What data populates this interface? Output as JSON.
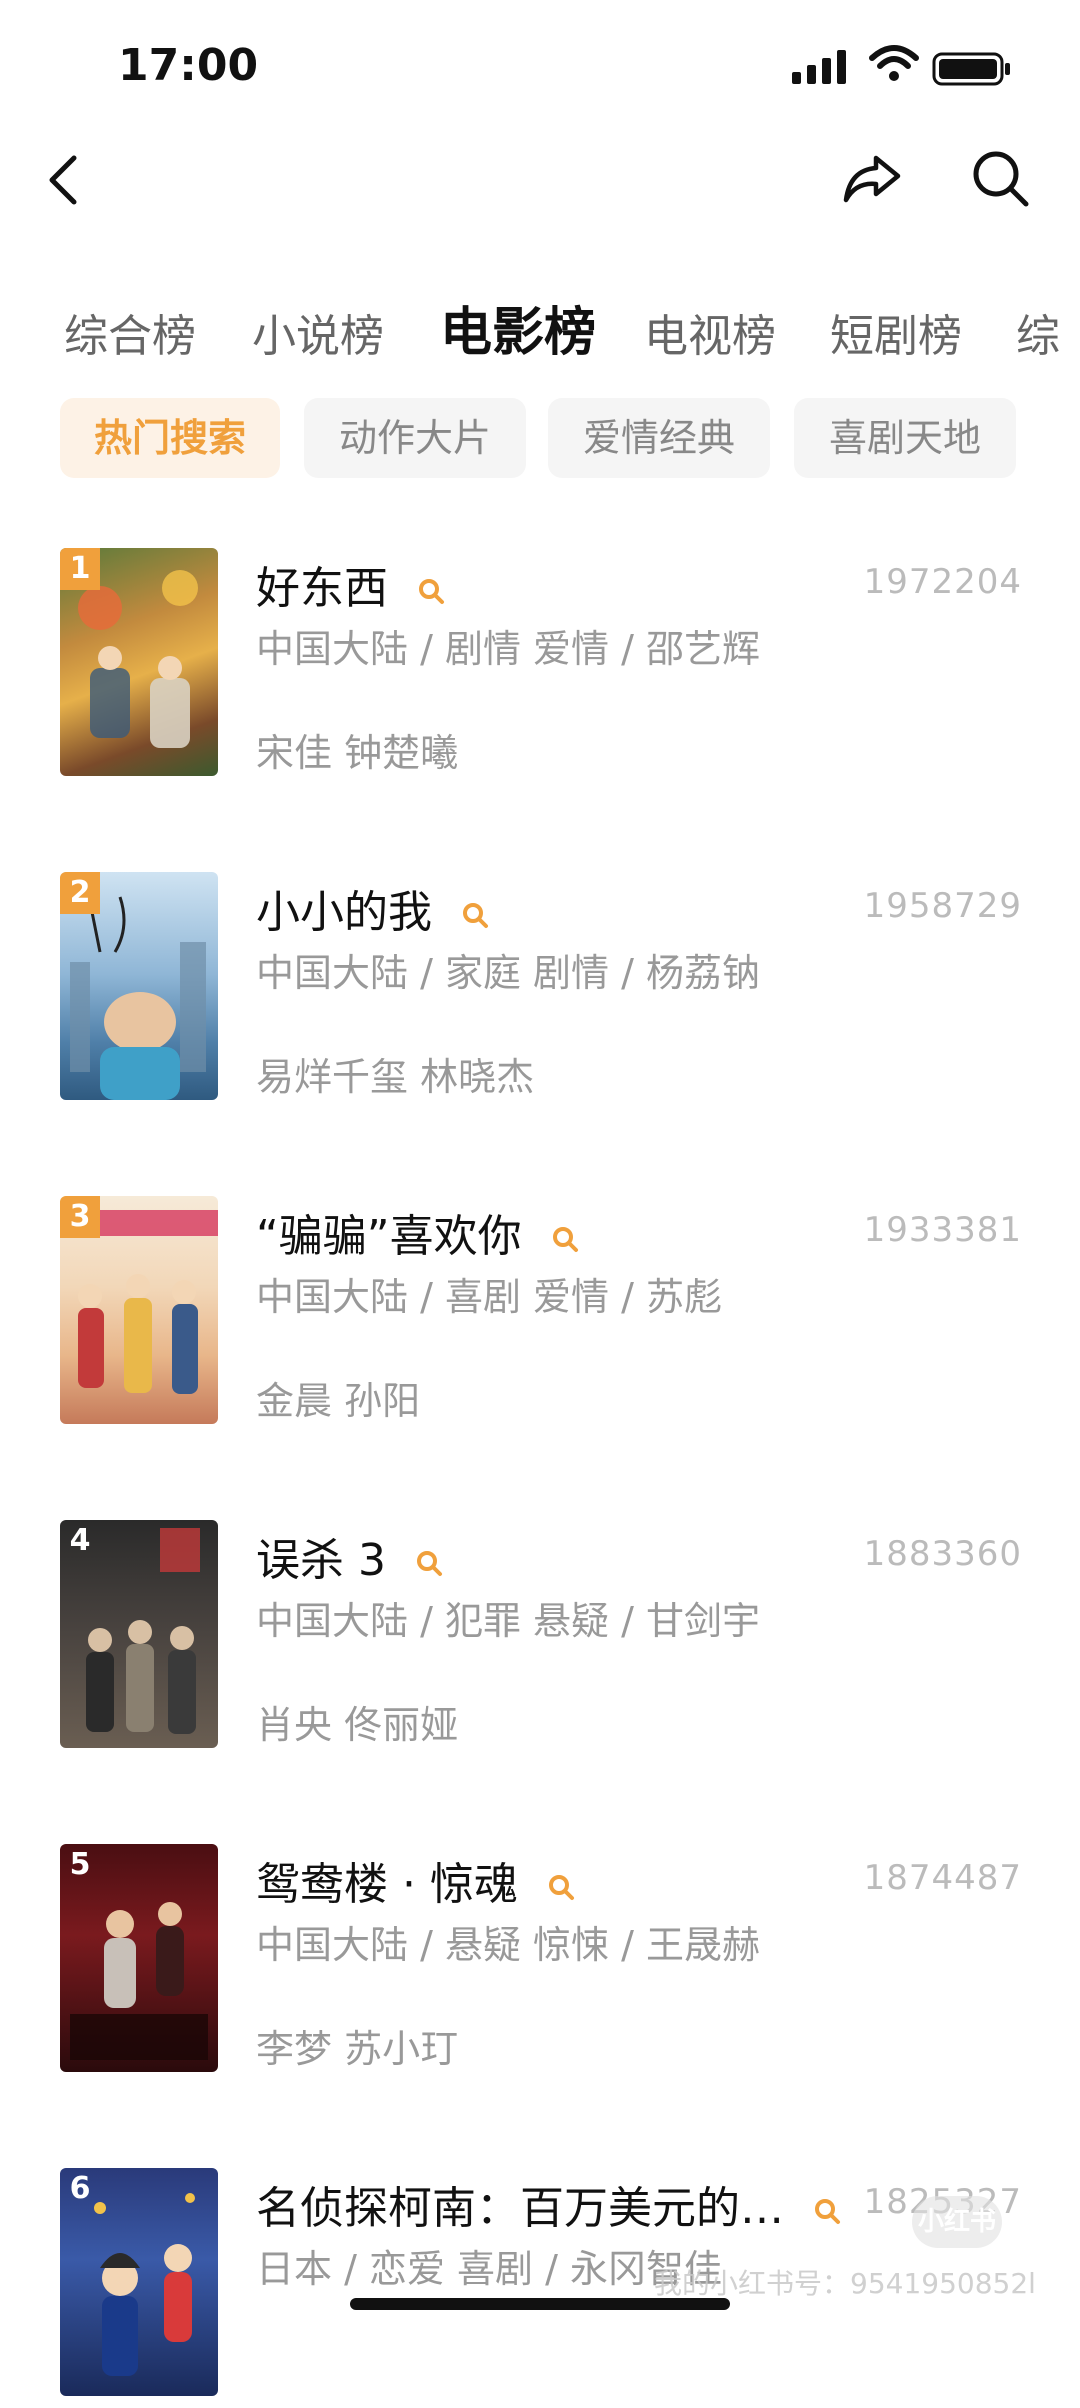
{
  "status_bar": {
    "time": "17:00"
  },
  "tabs": [
    "综合榜",
    "小说榜",
    "电影榜",
    "电视榜",
    "短剧榜",
    "综"
  ],
  "active_tab": "电影榜",
  "chips": [
    "热门搜索",
    "动作大片",
    "爱情经典",
    "喜剧天地"
  ],
  "active_chip": "热门搜索",
  "items": [
    {
      "rank": "1",
      "title": "好东西",
      "count": "1972204",
      "meta": "中国大陆 / 剧情 爱情 / 邵艺辉",
      "cast": "宋佳 钟楚曦"
    },
    {
      "rank": "2",
      "title": "小小的我",
      "count": "1958729",
      "meta": "中国大陆 / 家庭 剧情 / 杨荔钠",
      "cast": "易烊千玺 林晓杰"
    },
    {
      "rank": "3",
      "title": "“骗骗”喜欢你",
      "count": "1933381",
      "meta": "中国大陆 / 喜剧 爱情 / 苏彪",
      "cast": "金晨 孙阳"
    },
    {
      "rank": "4",
      "title": "误杀 3",
      "count": "1883360",
      "meta": "中国大陆 / 犯罪 悬疑 / 甘剑宇",
      "cast": "肖央 佟丽娅"
    },
    {
      "rank": "5",
      "title": "鸳鸯楼 · 惊魂",
      "count": "1874487",
      "meta": "中国大陆 / 悬疑 惊悚 / 王晟赫",
      "cast": "李梦 苏小玎"
    },
    {
      "rank": "6",
      "title": "名侦探柯南：百万美元的…",
      "count": "1825327",
      "meta": "日本 / 恋爱 喜剧 / 永冈智佳",
      "cast": ""
    }
  ],
  "watermark": {
    "text": "我的小红书号：9541950852l",
    "logo": "小红书"
  },
  "colors": {
    "accent": "#f0a03c",
    "chip_active_bg": "#fdf2e6",
    "chip_bg": "#f5f5f5",
    "text_muted": "#999999"
  },
  "icons": {
    "back": "chevron-left-icon",
    "share": "share-arrow-icon",
    "search": "search-icon",
    "item_search": "magnifier-icon"
  }
}
